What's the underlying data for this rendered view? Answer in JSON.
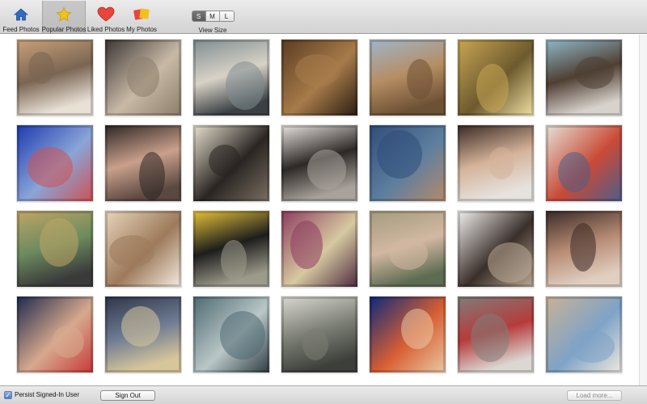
{
  "toolbar": {
    "tabs": [
      {
        "label": "Feed Photos",
        "icon": "home-icon"
      },
      {
        "label": "Popular Photos",
        "icon": "star-icon",
        "selected": true
      },
      {
        "label": "Liked Photos",
        "icon": "heart-icon"
      },
      {
        "label": "My Photos",
        "icon": "photos-icon"
      }
    ],
    "view_size": {
      "label": "View Size",
      "options": [
        "S",
        "M",
        "L"
      ],
      "selected": "S"
    }
  },
  "photos": [
    {
      "desc": "dog on bed",
      "colors": [
        "#c9a27a",
        "#7a6552",
        "#e8e1d6"
      ]
    },
    {
      "desc": "two women at vanity mirror",
      "colors": [
        "#3a3633",
        "#c8b9a6",
        "#8c7d6b"
      ]
    },
    {
      "desc": "woman in sunglasses car selfie",
      "colors": [
        "#7f8d91",
        "#d8d2c6",
        "#3b4044"
      ]
    },
    {
      "desc": "woman posing on rocks",
      "colors": [
        "#5a3c22",
        "#a77b4a",
        "#2a1d12"
      ]
    },
    {
      "desc": "desert hills landscape",
      "colors": [
        "#9fb6c9",
        "#b58d62",
        "#6d5135"
      ]
    },
    {
      "desc": "tunnel with lights",
      "colors": [
        "#c9a653",
        "#6d5a2e",
        "#f1e1a4"
      ]
    },
    {
      "desc": "hand holding cup",
      "colors": [
        "#8fb8c8",
        "#4f3f33",
        "#d7d2cc"
      ]
    },
    {
      "desc": "collage of photos",
      "colors": [
        "#1f3bb0",
        "#8aa5d8",
        "#cf5050"
      ]
    },
    {
      "desc": "woman portrait",
      "colors": [
        "#2d2624",
        "#caa08b",
        "#5b4840"
      ]
    },
    {
      "desc": "black pug",
      "colors": [
        "#e9e1d0",
        "#2a2522",
        "#7a6f63"
      ]
    },
    {
      "desc": "earrings on wall",
      "colors": [
        "#e7e2de",
        "#2c2826",
        "#a9a29c"
      ]
    },
    {
      "desc": "woman on rock in water",
      "colors": [
        "#2f4d7a",
        "#5e7f9e",
        "#b58a6a"
      ]
    },
    {
      "desc": "two women selfie",
      "colors": [
        "#3a2a24",
        "#d5b39a",
        "#e6e2de"
      ]
    },
    {
      "desc": "vintage toy car",
      "colors": [
        "#e5e1d8",
        "#c84a36",
        "#4d5e8b"
      ]
    },
    {
      "desc": "man selfie with cap",
      "colors": [
        "#c0a566",
        "#6c8b5e",
        "#3a3a3a"
      ]
    },
    {
      "desc": "woman in doorway",
      "colors": [
        "#e8d5bc",
        "#9d7a5b",
        "#f5ece0"
      ]
    },
    {
      "desc": "football fan Keisel jersey",
      "colors": [
        "#e6c23a",
        "#1d1d1d",
        "#9c9a8a"
      ]
    },
    {
      "desc": "woman in white dress in garden",
      "colors": [
        "#8c3b5e",
        "#d6c9a0",
        "#4d2b3e"
      ]
    },
    {
      "desc": "feet on pebbles",
      "colors": [
        "#a39c7c",
        "#d2b8a2",
        "#5d6b51"
      ]
    },
    {
      "desc": "man portrait collage",
      "colors": [
        "#f2f0ee",
        "#3a2f2a",
        "#bca995"
      ]
    },
    {
      "desc": "two women smiling",
      "colors": [
        "#3a2a26",
        "#b88c74",
        "#e0cfc1"
      ]
    },
    {
      "desc": "family photo collage",
      "colors": [
        "#1e2a4e",
        "#d7a98e",
        "#c73838"
      ]
    },
    {
      "desc": "city lights at night",
      "colors": [
        "#2f3548",
        "#6e7b93",
        "#d7c69a"
      ]
    },
    {
      "desc": "skateboarder water splash",
      "colors": [
        "#4e6a72",
        "#b9c7c7",
        "#2f3d44"
      ]
    },
    {
      "desc": "person walking dog palm trees",
      "colors": [
        "#d9d8d2",
        "#7b7e74",
        "#3d3f3b"
      ]
    },
    {
      "desc": "basketball player on screen",
      "colors": [
        "#0c2a7a",
        "#d85f33",
        "#e9c9a5"
      ]
    },
    {
      "desc": "group of friends outside",
      "colors": [
        "#7f7d7a",
        "#b73b3b",
        "#dbd7d2"
      ]
    },
    {
      "desc": "outfit flat lay",
      "colors": [
        "#c9b197",
        "#7fa3c6",
        "#efe9e0"
      ]
    }
  ],
  "bottombar": {
    "persist_label": "Persist Signed-In User",
    "persist_checked": "✓",
    "sign_out_label": "Sign Out",
    "load_more_label": "Load more..."
  }
}
